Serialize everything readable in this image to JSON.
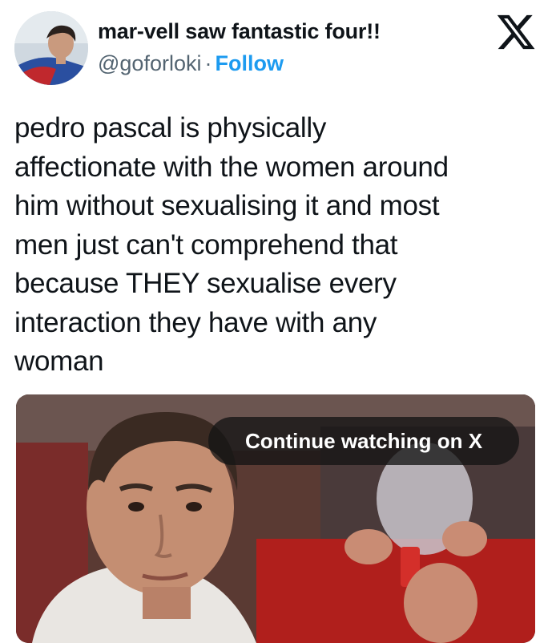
{
  "tweet": {
    "author": {
      "display_name": "mar-vell saw fantastic four!!",
      "handle": "@goforloki",
      "separator": "·",
      "follow_label": "Follow",
      "avatar_icon": "profile-avatar"
    },
    "platform_icon": "x-logo-icon",
    "text_lines": [
      "pedro pascal is physically",
      "affectionate with the women around",
      "him without sexualising it and most",
      "men just can't comprehend that",
      "because THEY sexualise every",
      "interaction they have with any",
      "woman"
    ],
    "media": {
      "overlay_label": "Continue watching on X"
    }
  },
  "colors": {
    "text_primary": "#0f1419",
    "text_secondary": "#536471",
    "link_blue": "#1d9bf0",
    "pill_background": "#141414"
  }
}
